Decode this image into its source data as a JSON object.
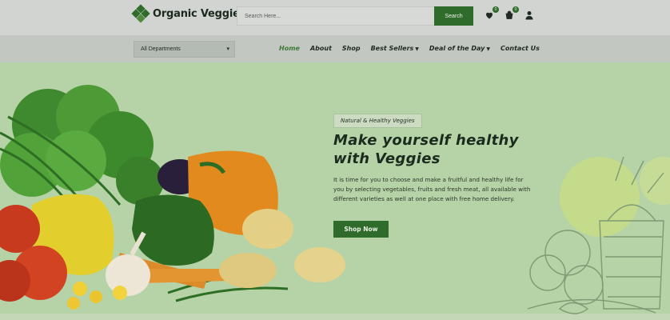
{
  "header": {
    "logo_text": "Organic Veggies",
    "search_placeholder": "Search Here...",
    "search_button": "Search",
    "wishlist_count": "0",
    "cart_count": "0",
    "icons": [
      "heart-icon",
      "cart-icon",
      "user-icon"
    ]
  },
  "nav": {
    "department_select": "All Departments",
    "items": [
      {
        "label": "Home",
        "active": true
      },
      {
        "label": "About"
      },
      {
        "label": "Shop"
      },
      {
        "label": "Best Sellers",
        "dropdown": true
      },
      {
        "label": "Deal of the Day",
        "dropdown": true
      },
      {
        "label": "Contact Us"
      }
    ]
  },
  "hero": {
    "tag": "Natural & Healthy Veggies",
    "headline_line1": "Make yourself healthy",
    "headline_line2": "with Veggies",
    "description": "It is time for you to choose and make a fruitful and healthy life for you by selecting vegetables, fruits and fresh meat, all available with different varieties as well at one place with free home delivery.",
    "cta": "Shop Now"
  },
  "colors": {
    "brand_green": "#2f6b2a",
    "active_nav": "#3d7a36",
    "hero_bg": "#b6d3a7"
  }
}
